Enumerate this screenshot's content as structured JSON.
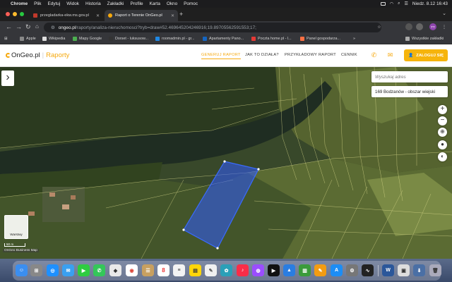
{
  "menubar": {
    "app": "Chrome",
    "items": [
      "Plik",
      "Edytuj",
      "Widok",
      "Historia",
      "Zakładki",
      "Profile",
      "Karta",
      "Okno",
      "Pomoc"
    ],
    "clock": "Niedz. 8.12  16:43"
  },
  "tabs": [
    {
      "title": "przegladarka-ekw.ms.gov.pl",
      "active": false
    },
    {
      "title": "Raport o Terenie OnGeo.pl",
      "active": true
    }
  ],
  "toolbar": {
    "url_host": "ongeo.pl",
    "url_path": "/raporty/analiza-nieruchomosci?tryb=draw#52.469645204246916;19.89705562591553;17;",
    "profile_initials": "TT"
  },
  "bookmarks": {
    "items": [
      "Apple",
      "Wikipedia",
      "Mapy Google",
      "Dorset - luksusow...",
      "roomadmin.pl - gr...",
      "Apartamenty Pano...",
      "Poczta home.pl - l...",
      "Panel gospodarza..."
    ],
    "all_label": "Wszystkie zakładki"
  },
  "site": {
    "logo_main": "OnGeo.pl",
    "logo_sub": "Raporty",
    "nav": [
      "GENERUJ RAPORT",
      "JAK TO DZIAŁA?",
      "PRZYKŁADOWY RAPORT",
      "CENNIK"
    ],
    "login": "ZALOGUJ SIĘ",
    "accent": "#f6a80d"
  },
  "map": {
    "search_placeholder": "Wyszukaj adres",
    "result": "169 Bodzanów - obszar wiejski",
    "minimap_label": "Warstwy",
    "scale": "50 m",
    "attribution": "OnGeo Business Map",
    "polygon_color": "#2f5bff"
  },
  "dock": {
    "calendar_day": "8"
  }
}
